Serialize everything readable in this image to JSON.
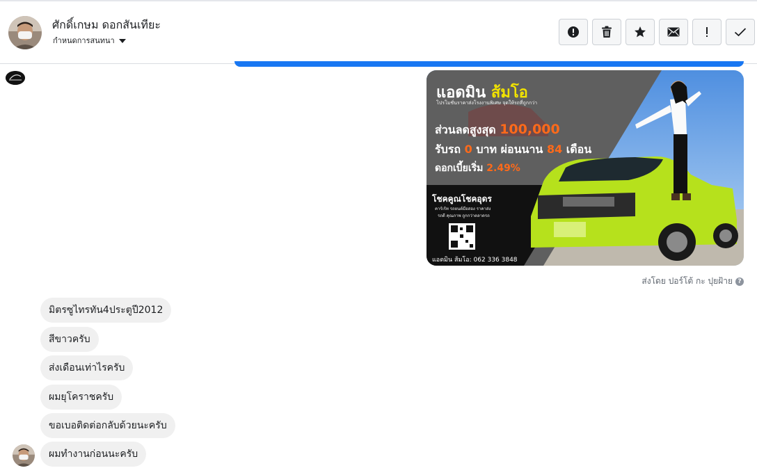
{
  "header": {
    "contact_name": "ศักดิ์เกษม ดอกสันเทียะ",
    "assign_label": "กำหนดการสนทนา",
    "tools": [
      {
        "name": "spam-button",
        "icon": "alert-circle-icon"
      },
      {
        "name": "delete-button",
        "icon": "trash-icon"
      },
      {
        "name": "star-button",
        "icon": "star-icon"
      },
      {
        "name": "mark-unread-button",
        "icon": "envelope-icon"
      },
      {
        "name": "follow-up-button",
        "icon": "exclamation-icon"
      },
      {
        "name": "done-button",
        "icon": "check-icon"
      }
    ]
  },
  "promo": {
    "headline_1": "แอดมิน",
    "headline_2": "ส้มโอ",
    "tagline": "โปรโมชั่นราคาส่งโรงงานพิเศษ จุดให้รถที่ถูกกว่า",
    "discount_label": "ส่วนลดสูงสุด",
    "discount_value": "100,000",
    "pickup_prefix": "รับรถ",
    "pickup_value": "0",
    "pickup_mid": "บาท ผ่อนนาน",
    "months_value": "84",
    "months_suffix": "เดือน",
    "interest_label": "ดอกเบี้ยเริ่ม",
    "interest_value": "2.49%",
    "lucky_title": "โชคคูณโชคอุดร",
    "lucky_sub_1": "คาร์เร้ท รถยนต์มือสอง ราคาส่ง",
    "lucky_sub_2": "รถดี คุณภาพ ถูกกว่าตลาดรถ",
    "contact": "แอดมิน ส้มโอ: 062 336 3848"
  },
  "sent_by": "ส่งโดย ปอร์โต้ กะ ปุยฝ้าย",
  "messages": [
    "มิตรซูไทรทัน4ประตูปี2012",
    "สีขาวครับ",
    "ส่งเดือนเท่าไรครับ",
    "ผมยุโคราชครับ",
    "ขอเบอติดต่อกลับด้วยนะครับ",
    "ผมทำงานก่อนนะครับ"
  ],
  "colors": {
    "accent": "#1877f2",
    "bubble": "#f0f0f0",
    "promo_orange": "#ff6a1a",
    "promo_yellow": "#f2e300",
    "car_green": "#b6e11c"
  }
}
